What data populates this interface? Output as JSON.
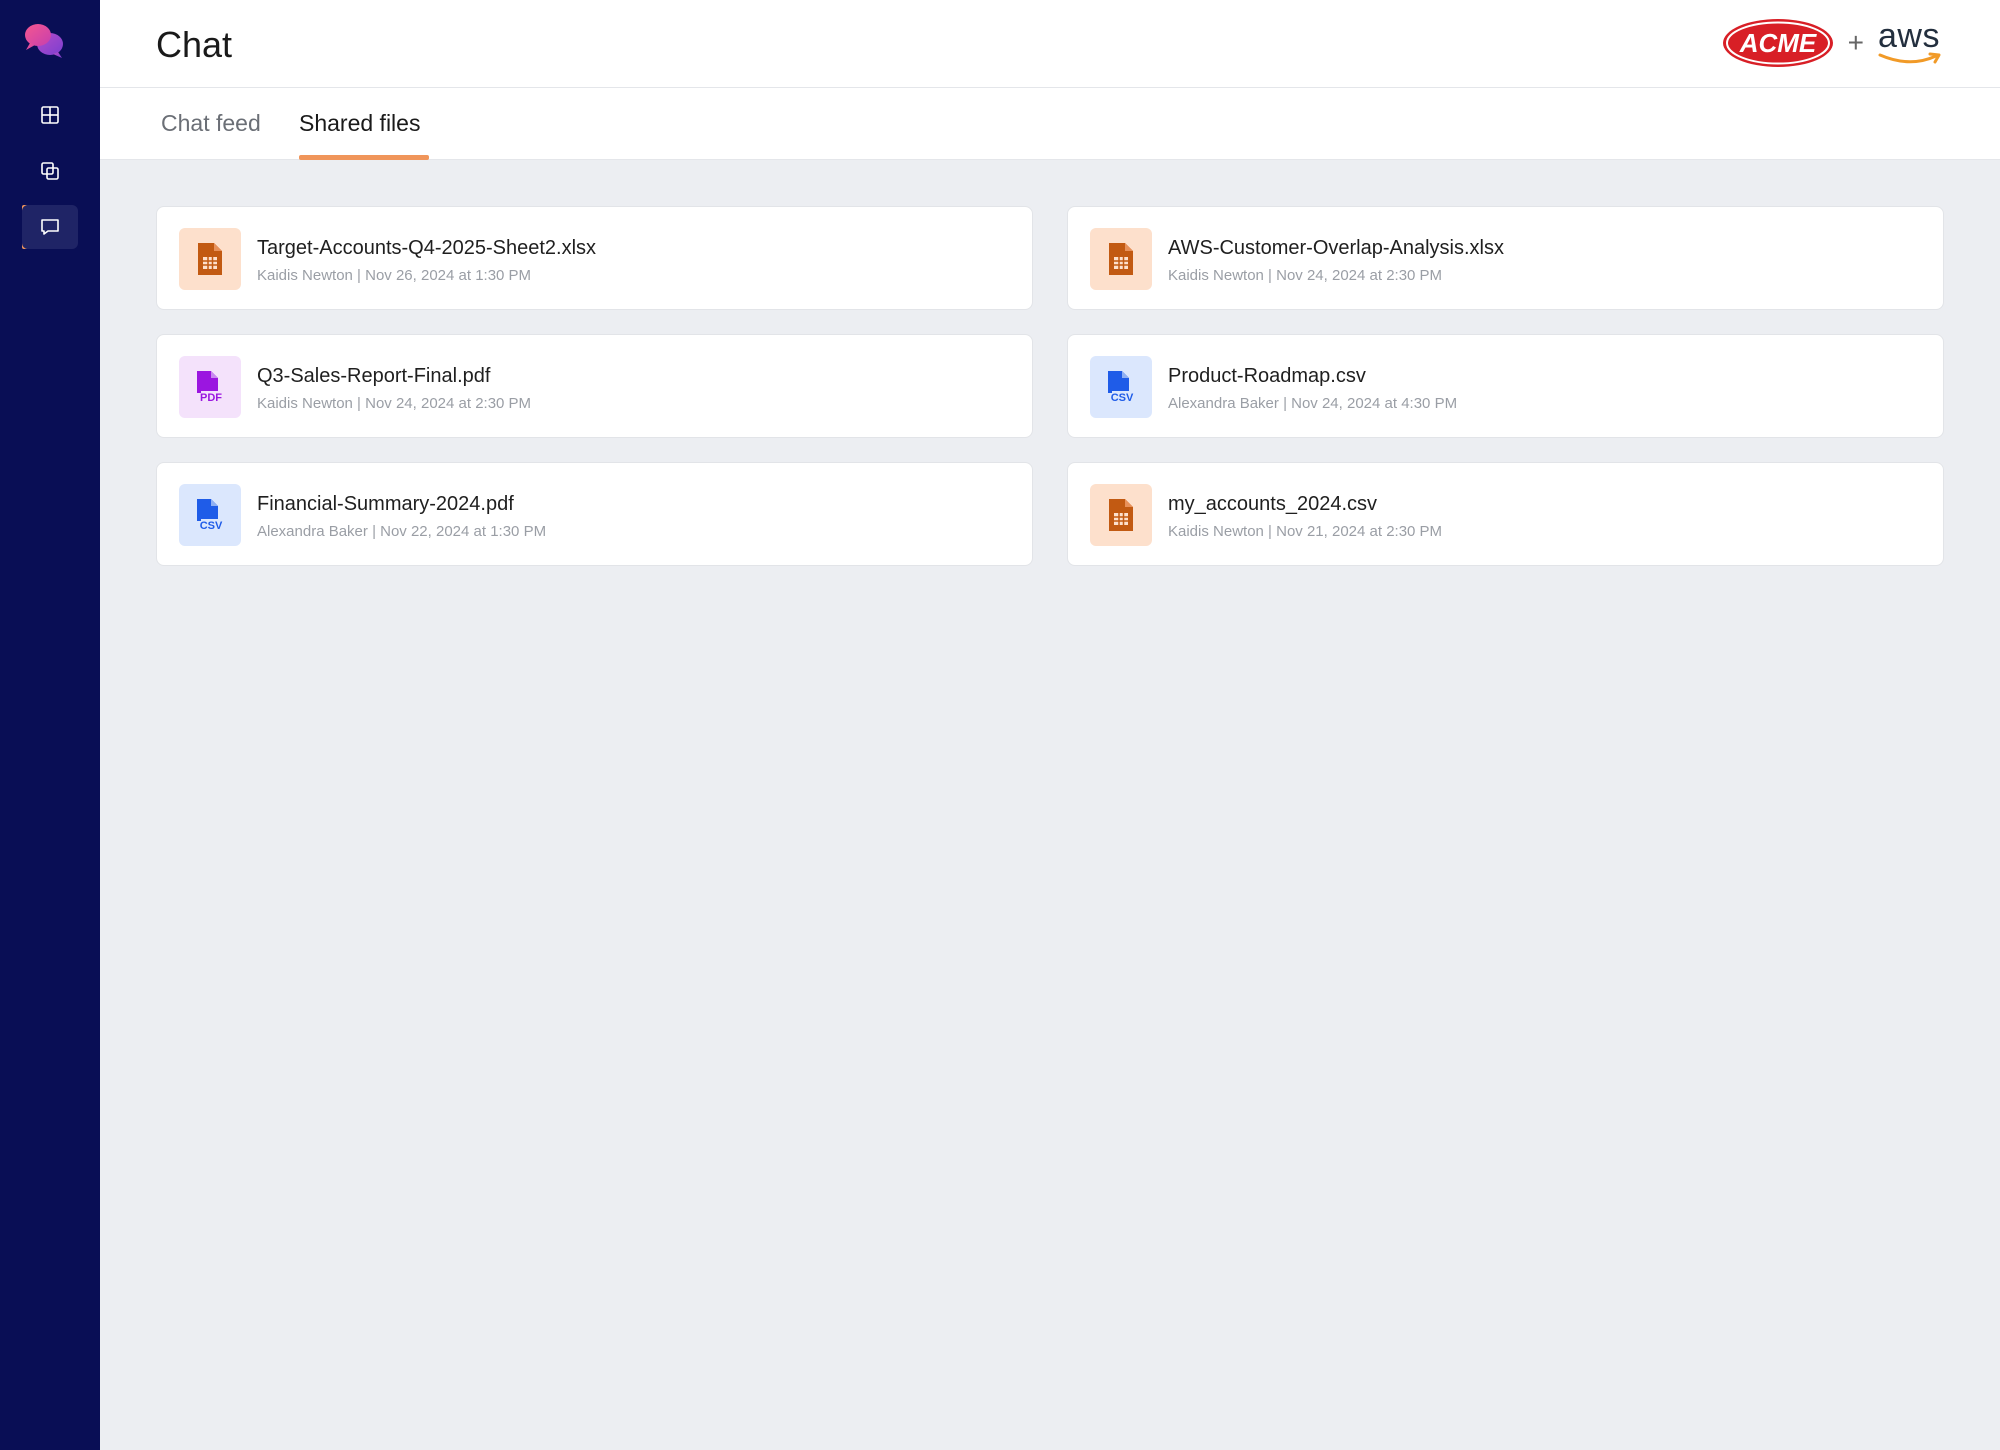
{
  "app": {
    "title": "Chat"
  },
  "brand": {
    "acme_text": "ACME",
    "plus": "+",
    "aws_text": "aws"
  },
  "sidebar": {
    "items": [
      {
        "name": "dashboard",
        "icon": "grid-icon"
      },
      {
        "name": "copy",
        "icon": "copy-icon"
      },
      {
        "name": "chat",
        "icon": "chat-bubble-icon",
        "active": true
      }
    ]
  },
  "tabs": [
    {
      "label": "Chat feed",
      "active": false
    },
    {
      "label": "Shared files",
      "active": true
    }
  ],
  "files": [
    {
      "name": "Target-Accounts-Q4-2025-Sheet2.xlsx",
      "meta": "Kaidis Newton | Nov 26, 2024 at 1:30 PM",
      "type": "sheet"
    },
    {
      "name": "AWS-Customer-Overlap-Analysis.xlsx",
      "meta": "Kaidis Newton | Nov 24, 2024 at 2:30 PM",
      "type": "sheet"
    },
    {
      "name": "Q3-Sales-Report-Final.pdf",
      "meta": "Kaidis Newton | Nov 24, 2024 at 2:30 PM",
      "type": "pdf",
      "icon_label": "PDF"
    },
    {
      "name": "Product-Roadmap.csv",
      "meta": "Alexandra Baker | Nov 24, 2024 at 4:30 PM",
      "type": "csv",
      "icon_label": "CSV"
    },
    {
      "name": "Financial-Summary-2024.pdf",
      "meta": "Alexandra Baker | Nov 22, 2024 at 1:30 PM",
      "type": "csv",
      "icon_label": "CSV"
    },
    {
      "name": "my_accounts_2024.csv",
      "meta": "Kaidis Newton | Nov 21, 2024 at 2:30 PM",
      "type": "sheet"
    }
  ],
  "colors": {
    "sidebar_bg": "#090e55",
    "accent": "#f0955a",
    "sheet_icon": "#c25a12",
    "pdf_icon": "#9b16e0",
    "csv_icon": "#1f5ce8"
  }
}
